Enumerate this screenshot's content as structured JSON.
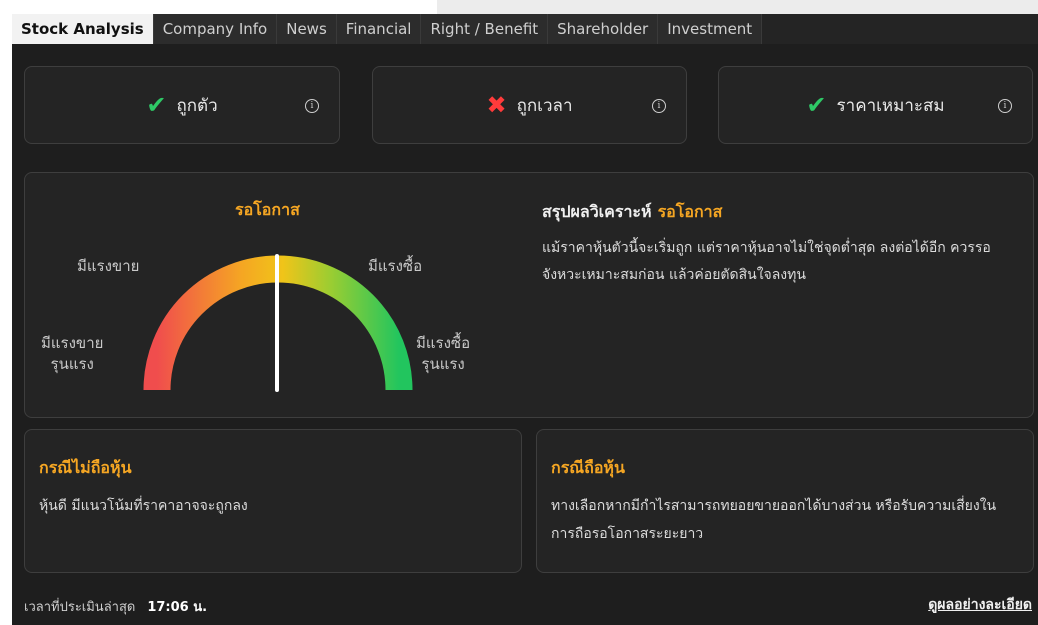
{
  "tabs": [
    {
      "label": "Stock Analysis",
      "active": true
    },
    {
      "label": "Company Info"
    },
    {
      "label": "News"
    },
    {
      "label": "Financial"
    },
    {
      "label": "Right / Benefit"
    },
    {
      "label": "Shareholder"
    },
    {
      "label": "Investment"
    }
  ],
  "status_cards": [
    {
      "label": "ถูกตัว",
      "mark": "✔",
      "state": "ok"
    },
    {
      "label": "ถูกเวลา",
      "mark": "✖",
      "state": "no"
    },
    {
      "label": "ราคาเหมาะสม",
      "mark": "✔",
      "state": "ok"
    }
  ],
  "info_glyph": "i",
  "gauge": {
    "title": "รอโอกาส",
    "level": 0.5,
    "labels": {
      "strong_sell_1": "มีแรงขาย",
      "strong_sell_2": "รุนแรง",
      "sell": "มีแรงขาย",
      "buy": "มีแรงซื้อ",
      "strong_buy_1": "มีแรงซื้อ",
      "strong_buy_2": "รุนแรง"
    },
    "colors": [
      "#f04d4d",
      "#f5a623",
      "#f0c419",
      "#9acd32",
      "#22c55e"
    ]
  },
  "summary": {
    "title": "สรุปผลวิเคราะห์",
    "verdict": "รอโอกาส",
    "text": "แม้ราคาหุ้นตัวนี้จะเริ่มถูก แต่ราคาหุ้นอาจไม่ใช่จุดต่ำสุด ลงต่อได้อีก ควรรอจังหวะเหมาะสมก่อน แล้วค่อยตัดสินใจลงทุน"
  },
  "cases": {
    "not_holding": {
      "title": "กรณีไม่ถือหุ้น",
      "text": "หุ้นดี มีแนวโน้มที่ราคาอาจจะถูกลง"
    },
    "holding": {
      "title": "กรณีถือหุ้น",
      "text": "ทางเลือกหากมีกำไรสามารถทยอยขายออกได้บางส่วน หรือรับความเสี่ยงในการถือรอโอกาสระยะยาว"
    }
  },
  "footer": {
    "label": "เวลาที่ประเมินล่าสุด",
    "time": "17:06 น.",
    "link": "ดูผลอย่างละเอียด"
  },
  "accent": "#f5a623"
}
